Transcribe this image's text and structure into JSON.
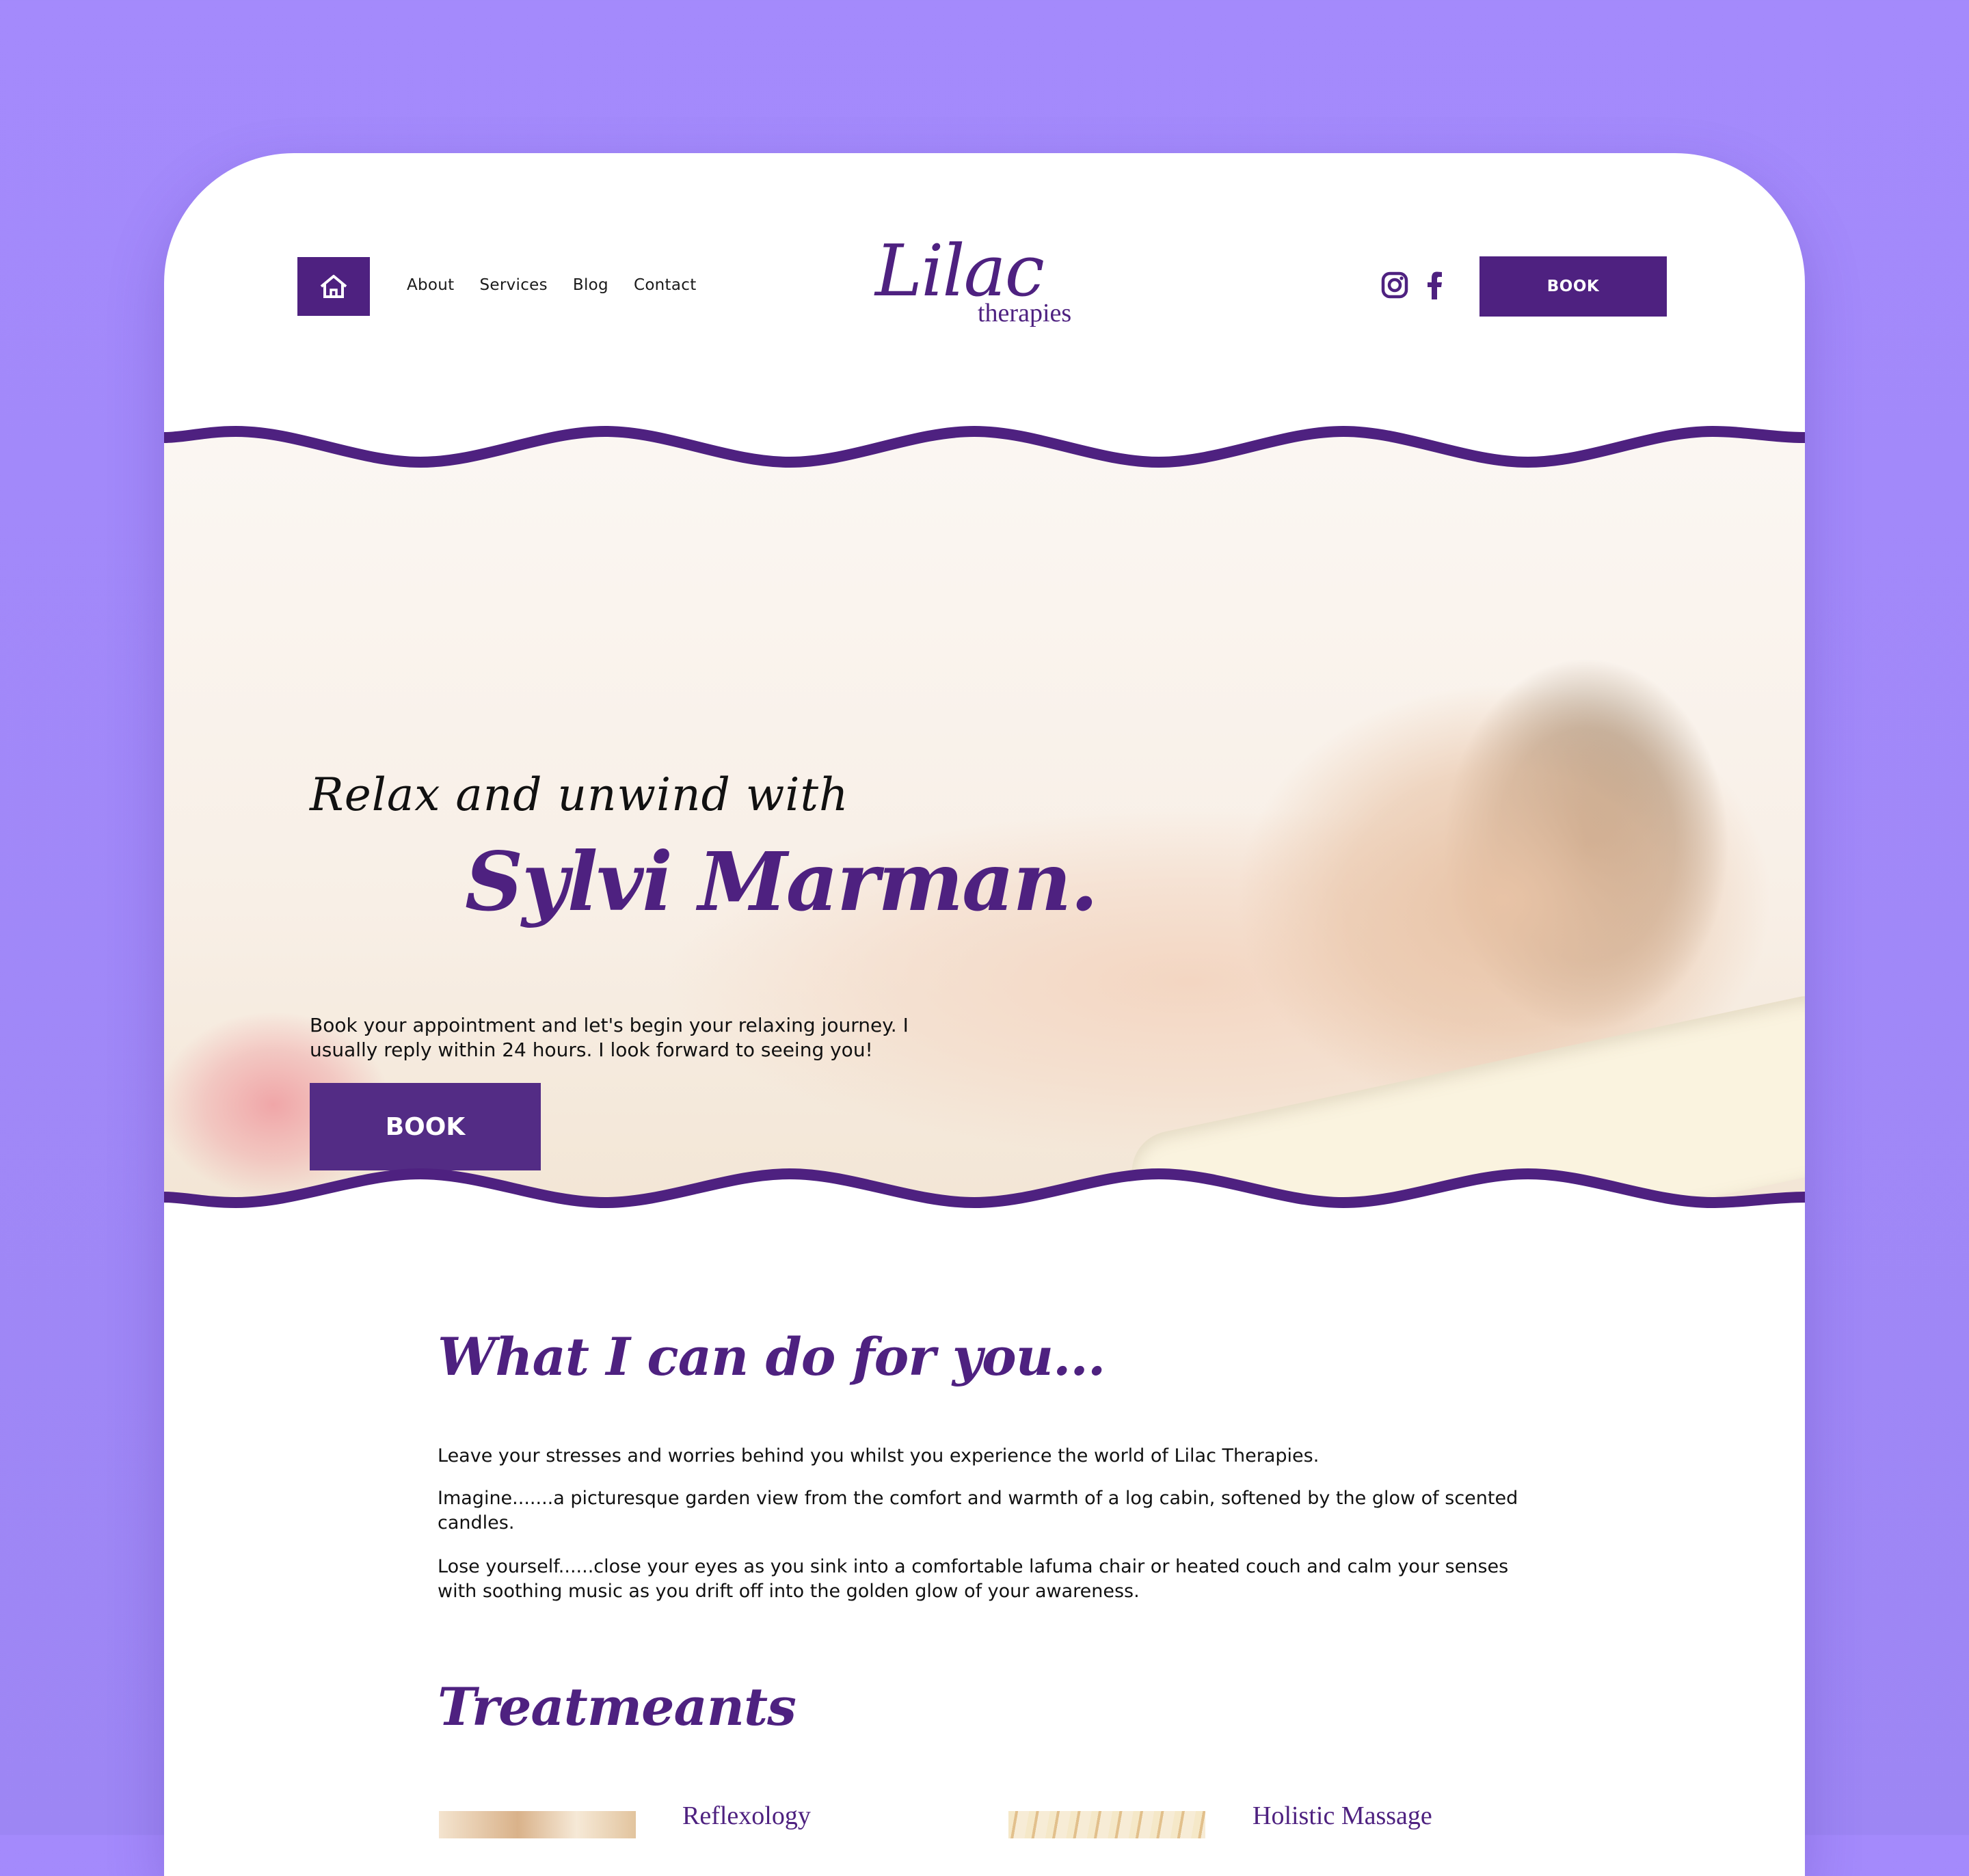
{
  "header": {
    "nav": [
      "About",
      "Services",
      "Blog",
      "Contact"
    ],
    "logo_script": "Lilac",
    "logo_sub": "therapies",
    "book_label": "BOOK"
  },
  "hero": {
    "kicker": "Relax and unwind with",
    "name": "Sylvi Marman.",
    "text": "Book your appointment and let's begin your relaxing journey. I usually reply within 24 hours. I look forward to seeing you!",
    "book_label": "BOOK"
  },
  "about": {
    "title": "What I can do for you...",
    "paragraphs": [
      "Leave your stresses and worries behind you whilst you experience the world of Lilac Therapies.",
      "Imagine.......a picturesque garden view from the comfort and warmth of a log cabin, softened by the glow of scented candles.",
      "Lose yourself......close your eyes as you sink into a comfortable lafuma chair or heated couch and calm your senses with soothing music as you drift off into the golden glow of your awareness."
    ]
  },
  "treatments": {
    "title": "Treatmeants",
    "items": [
      {
        "name": "Reflexology"
      },
      {
        "name": "Holistic Massage"
      }
    ]
  },
  "colors": {
    "background": "#a48afc",
    "brand_purple": "#4e2180",
    "button_purple": "#532c85"
  },
  "icons": [
    "home-icon",
    "instagram-icon",
    "facebook-icon"
  ]
}
